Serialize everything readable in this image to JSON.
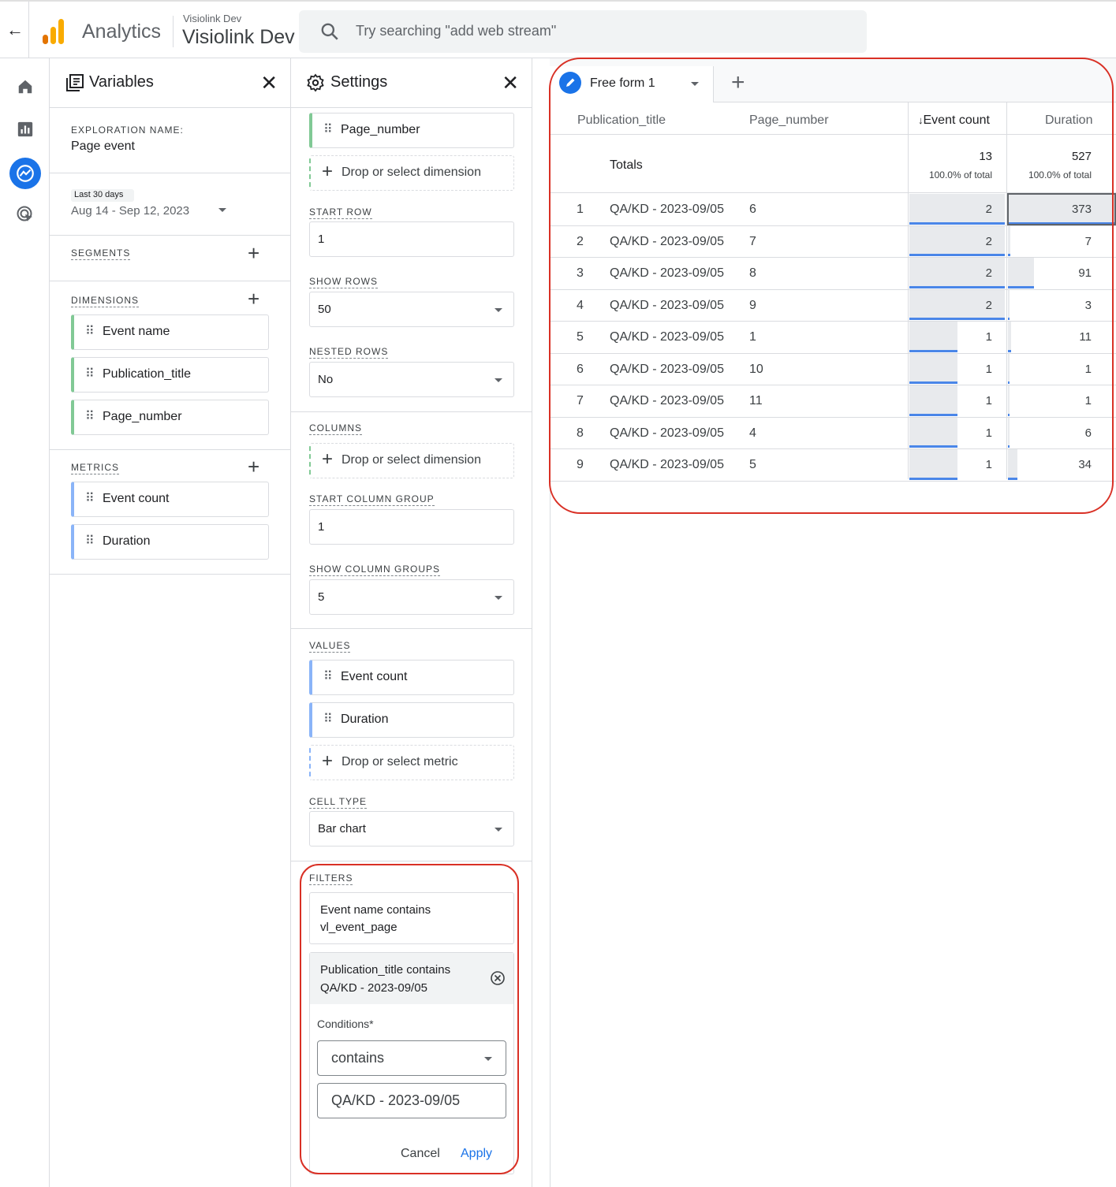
{
  "header": {
    "back_icon": "arrow-back-icon",
    "brand": "Analytics",
    "account_small": "Visiolink Dev",
    "account_big": "Visiolink Dev",
    "search_placeholder": "Try searching \"add web stream\""
  },
  "rail": [
    "home-icon",
    "reports-icon",
    "explore-icon",
    "advertising-icon"
  ],
  "variables": {
    "title": "Variables",
    "exploration_name_label": "EXPLORATION NAME:",
    "exploration_name": "Page event",
    "date_preset": "Last 30 days",
    "date_range": "Aug 14 - Sep 12, 2023",
    "segments_label": "SEGMENTS",
    "dimensions_label": "DIMENSIONS",
    "dimensions": [
      "Event name",
      "Publication_title",
      "Page_number"
    ],
    "metrics_label": "METRICS",
    "metrics": [
      "Event count",
      "Duration"
    ]
  },
  "settings": {
    "title": "Settings",
    "rows_chip": "Page_number",
    "drop_dimension": "Drop or select dimension",
    "start_row_label": "START ROW",
    "start_row": "1",
    "show_rows_label": "SHOW ROWS",
    "show_rows": "50",
    "nested_rows_label": "NESTED ROWS",
    "nested_rows": "No",
    "columns_label": "COLUMNS",
    "drop_dimension_cols": "Drop or select dimension",
    "start_col_group_label": "START COLUMN GROUP",
    "start_col_group": "1",
    "show_col_groups_label": "SHOW COLUMN GROUPS",
    "show_col_groups": "5",
    "values_label": "VALUES",
    "values": [
      "Event count",
      "Duration"
    ],
    "drop_metric": "Drop or select metric",
    "cell_type_label": "CELL TYPE",
    "cell_type": "Bar chart",
    "filters_label": "FILTERS",
    "filter1_line1": "Event name contains",
    "filter1_line2": "vl_event_page",
    "filter2_line1": "Publication_title contains",
    "filter2_line2": "QA/KD - 2023-09/05",
    "conditions_label": "Conditions*",
    "condition": "contains",
    "condition_value": "QA/KD - 2023-09/05",
    "cancel": "Cancel",
    "apply": "Apply"
  },
  "table": {
    "tab_name": "Free form 1",
    "columns": [
      "Publication_title",
      "Page_number",
      "Event count",
      "Duration"
    ],
    "sort_indicator": "↓",
    "totals_label": "Totals",
    "total_event_count": "13",
    "total_event_pct": "100.0% of total",
    "total_duration": "527",
    "total_duration_pct": "100.0% of total",
    "rows": [
      {
        "idx": "1",
        "title": "QA/KD - 2023-09/05",
        "page": "6",
        "events": 2,
        "duration": 373
      },
      {
        "idx": "2",
        "title": "QA/KD - 2023-09/05",
        "page": "7",
        "events": 2,
        "duration": 7
      },
      {
        "idx": "3",
        "title": "QA/KD - 2023-09/05",
        "page": "8",
        "events": 2,
        "duration": 91
      },
      {
        "idx": "4",
        "title": "QA/KD - 2023-09/05",
        "page": "9",
        "events": 2,
        "duration": 3
      },
      {
        "idx": "5",
        "title": "QA/KD - 2023-09/05",
        "page": "1",
        "events": 1,
        "duration": 11
      },
      {
        "idx": "6",
        "title": "QA/KD - 2023-09/05",
        "page": "10",
        "events": 1,
        "duration": 1
      },
      {
        "idx": "7",
        "title": "QA/KD - 2023-09/05",
        "page": "11",
        "events": 1,
        "duration": 1
      },
      {
        "idx": "8",
        "title": "QA/KD - 2023-09/05",
        "page": "4",
        "events": 1,
        "duration": 6
      },
      {
        "idx": "9",
        "title": "QA/KD - 2023-09/05",
        "page": "5",
        "events": 1,
        "duration": 34
      }
    ]
  },
  "colors": {
    "accent": "#1a73e8",
    "highlight": "#d93025",
    "bar_fill": "#e8eaed",
    "bar_line": "#4a86e8"
  }
}
